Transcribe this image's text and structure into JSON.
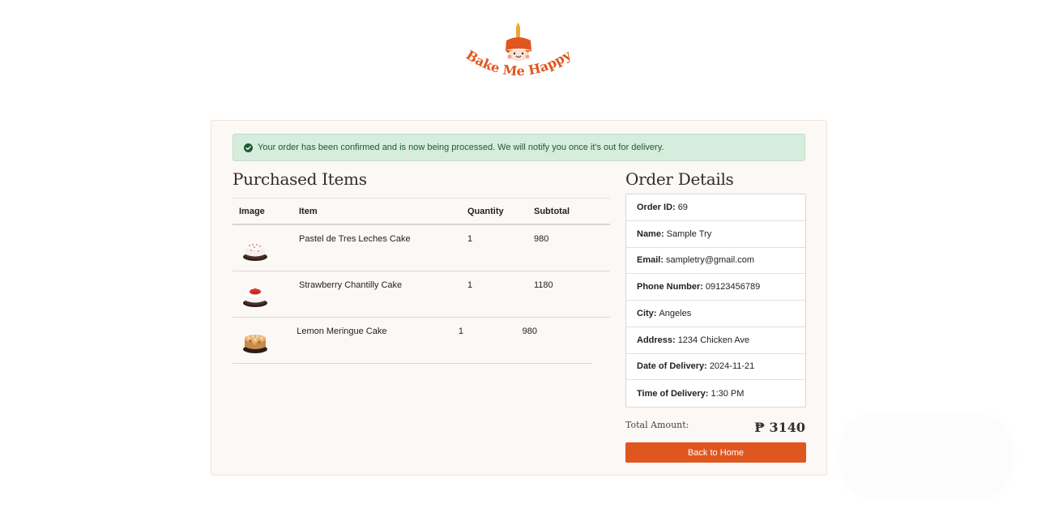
{
  "brand": {
    "name": "Bake Me Happy",
    "accent": "#e0561f"
  },
  "alert": {
    "icon": "check-circle-icon",
    "message": "Your order has been confirmed and is now being processed. We will notify you once it's out for delivery."
  },
  "purchased": {
    "heading": "Purchased Items",
    "columns": [
      "Image",
      "Item",
      "Quantity",
      "Subtotal"
    ],
    "rows": [
      {
        "image": "cake-white-icon",
        "item": "Pastel de Tres Leches Cake",
        "quantity": "1",
        "subtotal": "980"
      },
      {
        "image": "cake-strawberry-icon",
        "item": "Strawberry Chantilly Cake",
        "quantity": "1",
        "subtotal": "1180"
      },
      {
        "image": "cake-lemon-icon",
        "item": "Lemon Meringue Cake",
        "quantity": "1",
        "subtotal": "980"
      }
    ]
  },
  "details": {
    "heading": "Order Details",
    "order_id": {
      "label": "Order ID:",
      "value": "69"
    },
    "name": {
      "label": "Name:",
      "value": "Sample Try"
    },
    "email": {
      "label": "Email:",
      "value": "sampletry@gmail.com"
    },
    "phone": {
      "label": "Phone Number:",
      "value": "09123456789"
    },
    "city": {
      "label": "City:",
      "value": "Angeles"
    },
    "address": {
      "label": "Address:",
      "value": "1234 Chicken Ave"
    },
    "delivery_date": {
      "label": "Date of Delivery:",
      "value": "2024-11-21"
    },
    "delivery_time": {
      "label": "Time of Delivery:",
      "value": "1:30 PM"
    }
  },
  "total": {
    "label": "Total Amount:",
    "value": "₱ 3140"
  },
  "actions": {
    "back_home": "Back to Home"
  }
}
